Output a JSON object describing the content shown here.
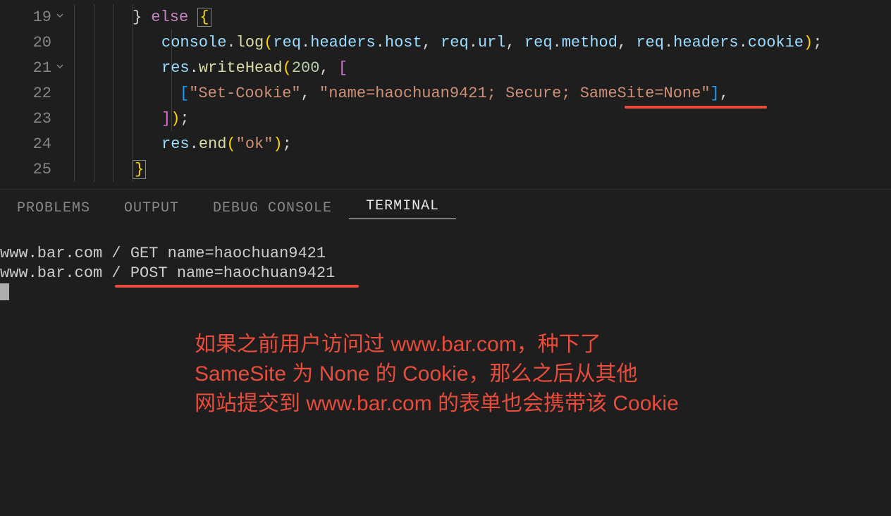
{
  "editor": {
    "lines": [
      {
        "number": "19",
        "fold": true
      },
      {
        "number": "20"
      },
      {
        "number": "21",
        "fold": true
      },
      {
        "number": "22"
      },
      {
        "number": "23"
      },
      {
        "number": "24"
      },
      {
        "number": "25"
      }
    ],
    "tokens": {
      "l19_brace": "}",
      "l19_else": "else",
      "l19_obrace": "{",
      "l20_console": "console",
      "l20_dot1": ".",
      "l20_log": "log",
      "l20_p1": "(",
      "l20_req1": "req",
      "l20_headers1": "headers",
      "l20_host": "host",
      "l20_c1": ", ",
      "l20_req2": "req",
      "l20_url": "url",
      "l20_c2": ", ",
      "l20_req3": "req",
      "l20_method": "method",
      "l20_c3": ", ",
      "l20_req4": "req",
      "l20_headers2": "headers",
      "l20_cookie": "cookie",
      "l20_p2": ")",
      "l20_semi": ";",
      "l21_res": "res",
      "l21_writeHead": "writeHead",
      "l21_p1": "(",
      "l21_200": "200",
      "l21_c1": ", ",
      "l21_bracket": "[",
      "l22_b1": "[",
      "l22_str1": "\"Set-Cookie\"",
      "l22_c1": ", ",
      "l22_str2": "\"name=haochuan9421; Secure; SameSite=None\"",
      "l22_b2": "]",
      "l22_c2": ",",
      "l23_b1": "]",
      "l23_p1": ")",
      "l23_semi": ";",
      "l24_res": "res",
      "l24_end": "end",
      "l24_p1": "(",
      "l24_str": "\"ok\"",
      "l24_p2": ")",
      "l24_semi": ";",
      "l25_brace": "}"
    }
  },
  "panel": {
    "tabs": {
      "problems": "PROBLEMS",
      "output": "OUTPUT",
      "debug": "DEBUG CONSOLE",
      "terminal": "TERMINAL"
    }
  },
  "terminal": {
    "line1": "www.bar.com / GET name=haochuan9421",
    "line2": "www.bar.com / POST name=haochuan9421"
  },
  "annotation": {
    "line1": "如果之前用户访问过 www.bar.com，种下了",
    "line2": "SameSite 为 None 的 Cookie，那么之后从其他",
    "line3": "网站提交到 www.bar.com 的表单也会携带该 Cookie"
  }
}
